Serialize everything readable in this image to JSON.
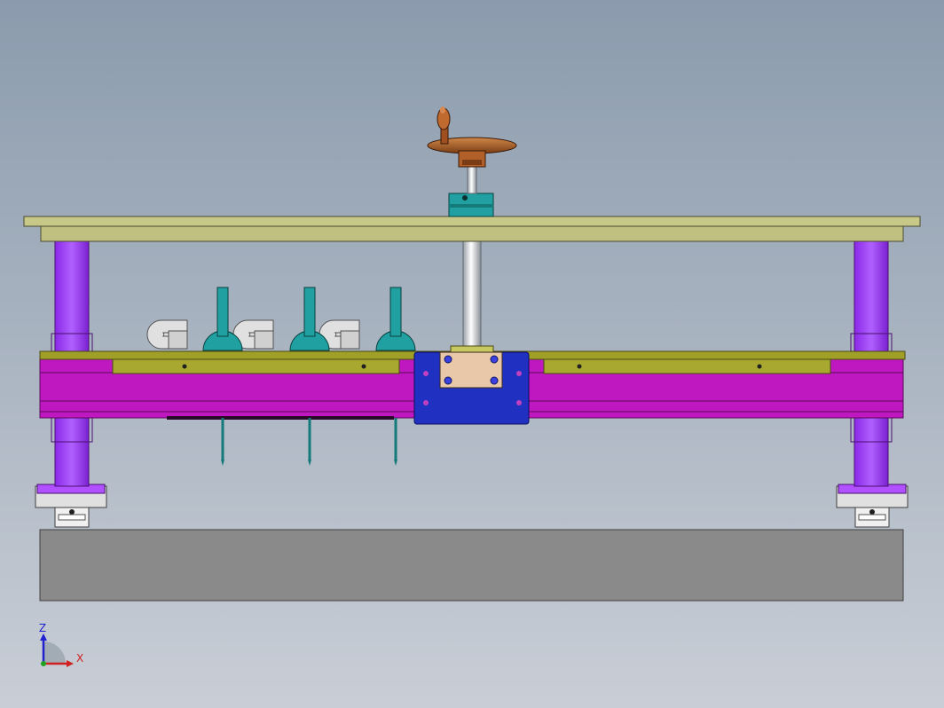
{
  "viewport": {
    "background_top": "#8b9bad",
    "background_bottom": "#c9ced6"
  },
  "triad": {
    "z_label": "Z",
    "x_label": "X",
    "z_color": "#2020d0",
    "x_color": "#d02020",
    "origin_color": "#20a020"
  },
  "palette": {
    "top_plate": "#c8c888",
    "top_plate_edge": "#4a4a30",
    "legs": "#a040ff",
    "legs_edge": "#4a1070",
    "beam": "#c018c0",
    "beam_edge": "#5a0a5a",
    "beam_top_rail": "#a0a028",
    "carriage_plate": "#2030c0",
    "carriage_inner": "#e8c8a8",
    "clamp_arms": "#20a0a0",
    "handwheel": "#b06028",
    "screw_rod": "#d8dde4",
    "base_block": "#8a8a8a",
    "base_edge": "#404040",
    "bearing_block": "#e0e0e0"
  },
  "model": {
    "clamp_count": 3,
    "hook_count": 3
  }
}
